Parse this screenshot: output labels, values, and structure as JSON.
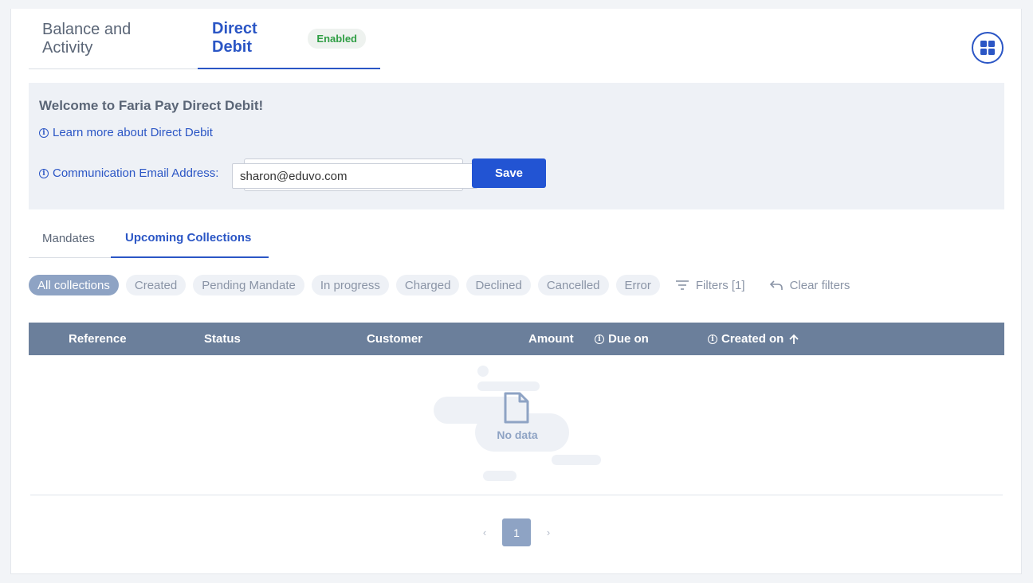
{
  "top_tabs": {
    "balance_label": "Balance and Activity",
    "direct_debit_label": "Direct Debit",
    "direct_debit_badge": "Enabled"
  },
  "welcome": {
    "title": "Welcome to Faria Pay Direct Debit!",
    "learn_more": "Learn more about Direct Debit",
    "email_label": "Communication Email Address:",
    "email_value": "sharon@eduvo.com",
    "save_label": "Save"
  },
  "sub_tabs": {
    "mandates": "Mandates",
    "upcoming": "Upcoming Collections"
  },
  "filters": {
    "chips": [
      "All collections",
      "Created",
      "Pending Mandate",
      "In progress",
      "Charged",
      "Declined",
      "Cancelled",
      "Error"
    ],
    "active_chip": "All collections",
    "filters_label": "Filters [1]",
    "clear_label": "Clear filters"
  },
  "table": {
    "columns": {
      "reference": "Reference",
      "status": "Status",
      "customer": "Customer",
      "amount": "Amount",
      "due_on": "Due on",
      "created_on": "Created on"
    },
    "empty_text": "No data"
  },
  "pagination": {
    "current_page": "1",
    "prev": "‹",
    "next": "›"
  },
  "colors": {
    "accent": "#2b56c5",
    "save_button": "#2254d3",
    "header_bg": "#6b7f9b",
    "chip_active": "#8ea3c4",
    "badge_text": "#2f9e44"
  }
}
